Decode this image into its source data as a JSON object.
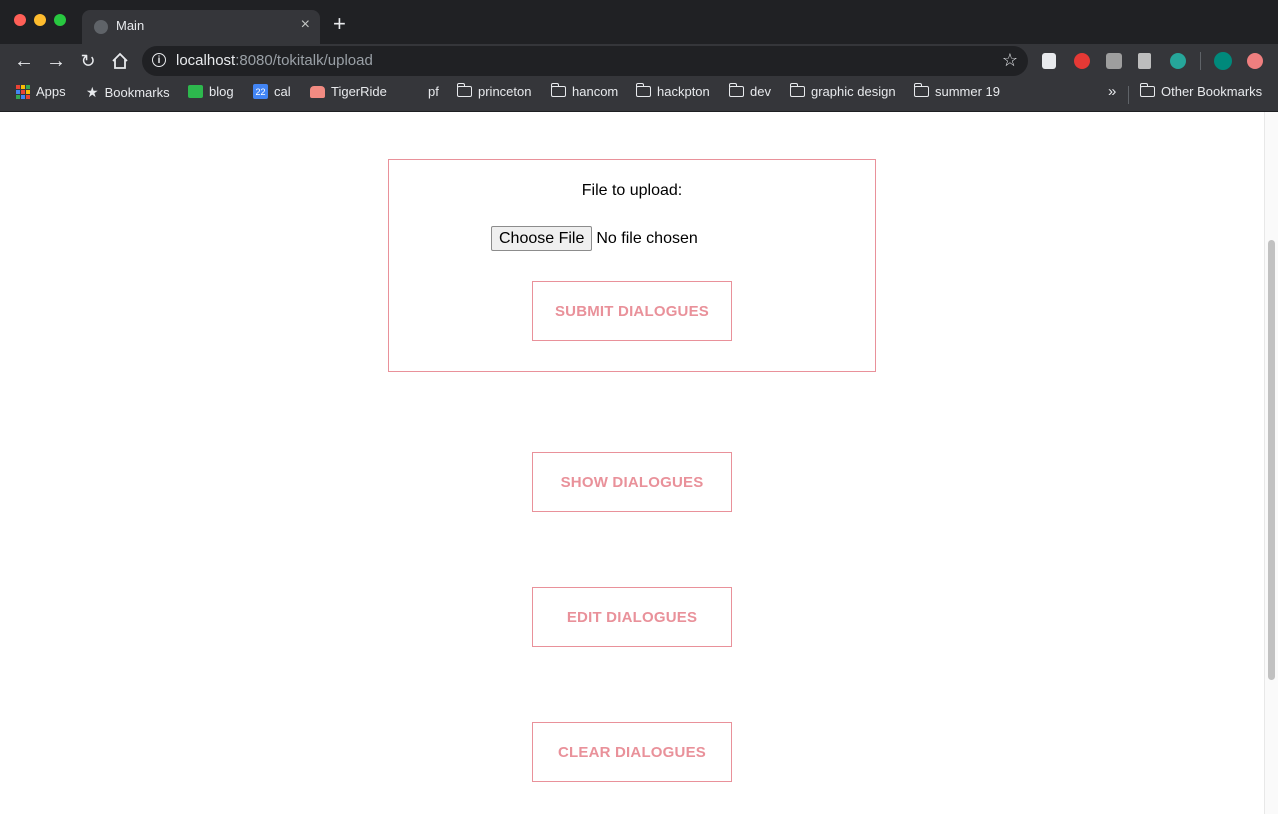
{
  "window": {
    "tab_title": "Main",
    "tab_close": "×",
    "new_tab": "+"
  },
  "toolbar": {
    "url_host": "localhost",
    "url_path": ":8080/tokitalk/upload",
    "info": "i",
    "star": "☆"
  },
  "bookmarks": {
    "items": [
      {
        "label": "Apps"
      },
      {
        "label": "Bookmarks"
      },
      {
        "label": "blog"
      },
      {
        "label": "cal",
        "badge": "22"
      },
      {
        "label": "TigerRide"
      },
      {
        "label": "pf"
      },
      {
        "label": "princeton"
      },
      {
        "label": "hancom"
      },
      {
        "label": "hackpton"
      },
      {
        "label": "dev"
      },
      {
        "label": "graphic design"
      },
      {
        "label": "summer 19"
      }
    ],
    "overflow": "»",
    "other": "Other Bookmarks"
  },
  "upload": {
    "label": "File to upload:",
    "choose_button": "Choose File",
    "no_file": "No file chosen",
    "submit_button": "SUBMIT DIALOGUES"
  },
  "actions": {
    "show": "SHOW DIALOGUES",
    "edit": "EDIT DIALOGUES",
    "clear": "CLEAR DIALOGUES"
  },
  "colors": {
    "accent": "#e9919a",
    "chrome_dark": "#202124",
    "chrome_toolbar": "#35363a"
  }
}
